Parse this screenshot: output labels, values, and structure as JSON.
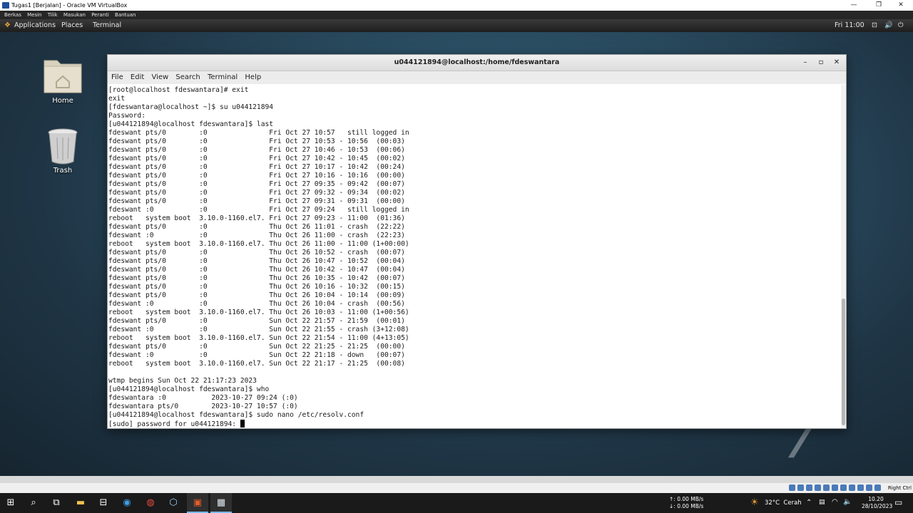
{
  "vbox": {
    "title": "Tugas1 [Berjalan] - Oracle VM VirtualBox",
    "menu": [
      "Berkas",
      "Mesin",
      "Tilik",
      "Masukan",
      "Peranti",
      "Bantuan"
    ]
  },
  "gnome": {
    "applications": "Applications",
    "places": "Places",
    "terminal": "Terminal",
    "clock": "Fri 11:00"
  },
  "desktop": {
    "home_label": "Home",
    "trash_label": "Trash",
    "watermark": "7"
  },
  "terminal": {
    "title": "u044121894@localhost:/home/fdeswantara",
    "menu": [
      "File",
      "Edit",
      "View",
      "Search",
      "Terminal",
      "Help"
    ],
    "output": "[root@localhost fdeswantara]# exit\nexit\n[fdeswantara@localhost ~]$ su u044121894\nPassword:\n[u044121894@localhost fdeswantara]$ last\nfdeswant pts/0        :0               Fri Oct 27 10:57   still logged in\nfdeswant pts/0        :0               Fri Oct 27 10:53 - 10:56  (00:03)\nfdeswant pts/0        :0               Fri Oct 27 10:46 - 10:53  (00:06)\nfdeswant pts/0        :0               Fri Oct 27 10:42 - 10:45  (00:02)\nfdeswant pts/0        :0               Fri Oct 27 10:17 - 10:42  (00:24)\nfdeswant pts/0        :0               Fri Oct 27 10:16 - 10:16  (00:00)\nfdeswant pts/0        :0               Fri Oct 27 09:35 - 09:42  (00:07)\nfdeswant pts/0        :0               Fri Oct 27 09:32 - 09:34  (00:02)\nfdeswant pts/0        :0               Fri Oct 27 09:31 - 09:31  (00:00)\nfdeswant :0           :0               Fri Oct 27 09:24   still logged in\nreboot   system boot  3.10.0-1160.el7. Fri Oct 27 09:23 - 11:00  (01:36)\nfdeswant pts/0        :0               Thu Oct 26 11:01 - crash  (22:22)\nfdeswant :0           :0               Thu Oct 26 11:00 - crash  (22:23)\nreboot   system boot  3.10.0-1160.el7. Thu Oct 26 11:00 - 11:00 (1+00:00)\nfdeswant pts/0        :0               Thu Oct 26 10:52 - crash  (00:07)\nfdeswant pts/0        :0               Thu Oct 26 10:47 - 10:52  (00:04)\nfdeswant pts/0        :0               Thu Oct 26 10:42 - 10:47  (00:04)\nfdeswant pts/0        :0               Thu Oct 26 10:35 - 10:42  (00:07)\nfdeswant pts/0        :0               Thu Oct 26 10:16 - 10:32  (00:15)\nfdeswant pts/0        :0               Thu Oct 26 10:04 - 10:14  (00:09)\nfdeswant :0           :0               Thu Oct 26 10:04 - crash  (00:56)\nreboot   system boot  3.10.0-1160.el7. Thu Oct 26 10:03 - 11:00 (1+00:56)\nfdeswant pts/0        :0               Sun Oct 22 21:57 - 21:59  (00:01)\nfdeswant :0           :0               Sun Oct 22 21:55 - crash (3+12:08)\nreboot   system boot  3.10.0-1160.el7. Sun Oct 22 21:54 - 11:00 (4+13:05)\nfdeswant pts/0        :0               Sun Oct 22 21:25 - 21:25  (00:00)\nfdeswant :0           :0               Sun Oct 22 21:18 - down   (00:07)\nreboot   system boot  3.10.0-1160.el7. Sun Oct 22 21:17 - 21:25  (00:08)\n\nwtmp begins Sun Oct 22 21:17:23 2023\n[u044121894@localhost fdeswantara]$ who\nfdeswantara :0           2023-10-27 09:24 (:0)\nfdeswantara pts/0        2023-10-27 10:57 (:0)\n[u044121894@localhost fdeswantara]$ sudo nano /etc/resolv.conf\n[sudo] password for u044121894: "
  },
  "vm_status": {
    "host_key": "Right Ctrl"
  },
  "taskbar": {
    "net_up": "↑: 0.00 MB/s",
    "net_down": "↓: 0.00 MB/s",
    "weather": "32°C  Cerah",
    "time": "10.20",
    "date": "28/10/2023"
  }
}
